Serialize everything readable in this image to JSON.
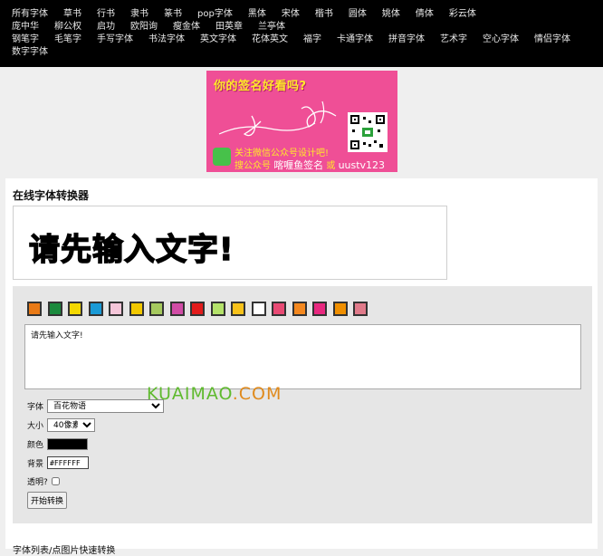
{
  "nav": {
    "rows": [
      [
        "所有字体",
        "草书",
        "行书",
        "隶书",
        "篆书",
        "pop字体",
        "黑体",
        "宋体",
        "楷书",
        "圆体",
        "姚体",
        "倩体",
        "彩云体"
      ],
      [
        "庞中华",
        "柳公权",
        "启功",
        "欧阳询",
        "瘦金体",
        "田英章",
        "兰亭体"
      ],
      [
        "钢笔字",
        "毛笔字",
        "手写字体",
        "书法字体",
        "英文字体",
        "花体英文",
        "福字",
        "卡通字体",
        "拼音字体",
        "艺术字",
        "空心字体",
        "情侣字体"
      ],
      [
        "数字字体"
      ]
    ]
  },
  "banner": {
    "question": "你的签名好看吗?",
    "line1": "关注微信公众号设计吧!",
    "line2_prefix": "搜公众号",
    "line2_name": "喀喱鱼签名",
    "line2_or": "或",
    "line2_id": "uustv123"
  },
  "tool": {
    "title": "在线字体转换器",
    "preview_text": "请先输入文字!",
    "swatch_colors": [
      "#e97a16",
      "#1b8a3d",
      "#f4d800",
      "#1a9ad6",
      "#f5c6d9",
      "#f2c800",
      "#a6c95e",
      "#d14ca6",
      "#e21b1b",
      "#b4e26a",
      "#f7c21a",
      "#ffffff",
      "#e84a74",
      "#f4881f",
      "#e8287f",
      "#f08f00",
      "#e07a8a"
    ],
    "textarea_value": "请先输入文字!",
    "font_label": "字体",
    "font_selected": "百花物语",
    "size_label": "大小",
    "size_selected": "40像素",
    "color_label": "颜色",
    "bg_label": "背景",
    "bg_value": "#FFFFFF",
    "transparent_label": "透明?",
    "convert_button": "开始转换"
  },
  "watermark": {
    "part1": "KUAIMAO",
    "part2": ".COM"
  },
  "footer": {
    "text": "字体列表/点图片快速转换"
  }
}
